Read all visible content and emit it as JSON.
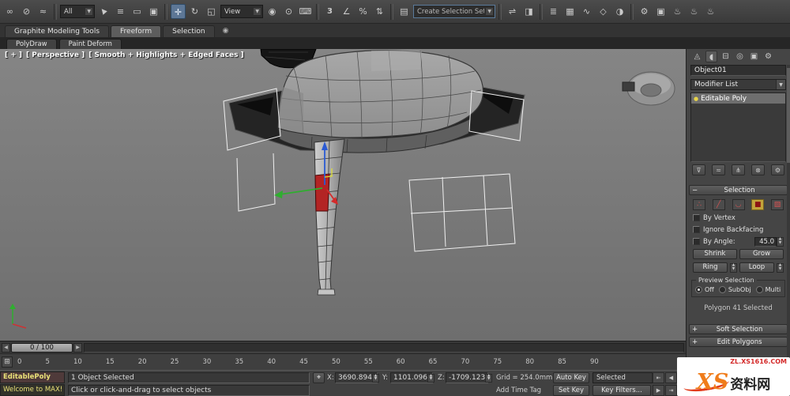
{
  "colors": {
    "selected_red": "#b32424",
    "gizmo_x": "#d42a2a",
    "gizmo_y": "#2fae2f",
    "gizmo_z": "#2a5ad4",
    "so_active_bg": "#c2a43c",
    "watermark_orange": "#f07c1a",
    "watermark_red": "#d42a2a"
  },
  "icons": {
    "dropdown_arrow": "▼",
    "spinner_up": "▲",
    "spinner_down": "▼",
    "rollout_open": "−",
    "rollout_closed": "+",
    "slider_left_arrow": "◀",
    "slider_right_arrow": "▶",
    "mini_curve_editor": "⊞",
    "stack_item_bulb": "●",
    "absolute_mode": "⌖",
    "ribbon_options": "◉"
  },
  "toolbar": {
    "items": [
      {
        "name": "select-and-link-icon",
        "glyph": "∞",
        "cls": "tb-icon"
      },
      {
        "name": "unlink-selection-icon",
        "glyph": "⊘",
        "cls": "tb-icon"
      },
      {
        "name": "bind-to-space-warp-icon",
        "glyph": "≈",
        "cls": "tb-icon"
      },
      {
        "kind": "sep",
        "name": "toolbar-separator",
        "cls": "tbsep",
        "interactable": false
      },
      {
        "kind": "drop",
        "name": "selection-filter-dropdown",
        "value": "All",
        "cls": "tb-drop w44"
      },
      {
        "name": "select-object-icon",
        "glyph": "▲",
        "cls": "tb-icon cursorrot"
      },
      {
        "name": "select-by-name-icon",
        "glyph": "≡",
        "cls": "tb-icon"
      },
      {
        "name": "rectangular-selection-region-icon",
        "glyph": "▭",
        "cls": "tb-icon"
      },
      {
        "name": "window-crossing-toggle-icon",
        "glyph": "▣",
        "cls": "tb-icon"
      },
      {
        "kind": "sep",
        "name": "toolbar-separator",
        "cls": "tbsep",
        "interactable": false
      },
      {
        "name": "select-and-move-icon",
        "glyph": "✛",
        "cls": "tb-icon active"
      },
      {
        "name": "select-and-rotate-icon",
        "glyph": "↻",
        "cls": "tb-icon"
      },
      {
        "name": "select-and-scale-icon",
        "glyph": "◱",
        "cls": "tb-icon"
      },
      {
        "kind": "drop",
        "name": "reference-coordinate-dropdown",
        "value": "View",
        "cls": "tb-drop w54"
      },
      {
        "name": "use-pivot-point-center-icon",
        "glyph": "◉",
        "cls": "tb-icon"
      },
      {
        "name": "select-and-manipulate-icon",
        "glyph": "⊙",
        "cls": "tb-icon"
      },
      {
        "name": "keyboard-shortcut-override-icon",
        "glyph": "⌨",
        "cls": "tb-icon"
      },
      {
        "kind": "sep",
        "name": "toolbar-separator",
        "cls": "tbsep",
        "interactable": false
      },
      {
        "name": "snaps-toggle-icon",
        "glyph": "3",
        "cls": "tb-icon snapnum"
      },
      {
        "name": "angle-snap-icon",
        "glyph": "∠",
        "cls": "tb-icon"
      },
      {
        "name": "percent-snap-icon",
        "glyph": "%",
        "cls": "tb-icon"
      },
      {
        "name": "spinner-snap-icon",
        "glyph": "⇅",
        "cls": "tb-icon"
      },
      {
        "kind": "sep",
        "name": "toolbar-separator",
        "cls": "tbsep",
        "interactable": false
      },
      {
        "name": "edit-named-selection-sets-icon",
        "glyph": "▤",
        "cls": "tb-icon"
      },
      {
        "kind": "drop",
        "name": "named-selection-set-combobox",
        "value": "Create Selection Set",
        "cls": "tb-drop combo w104"
      },
      {
        "kind": "sep",
        "name": "toolbar-separator",
        "cls": "tbsep",
        "interactable": false
      },
      {
        "name": "mirror-icon",
        "glyph": "⇌",
        "cls": "tb-icon"
      },
      {
        "name": "align-icon",
        "glyph": "◨",
        "cls": "tb-icon"
      },
      {
        "kind": "sep",
        "name": "toolbar-separator",
        "cls": "tbsep",
        "interactable": false
      },
      {
        "name": "layer-manager-icon",
        "glyph": "≣",
        "cls": "tb-icon"
      },
      {
        "name": "graphite-ribbon-toggle-icon",
        "glyph": "▦",
        "cls": "tb-icon"
      },
      {
        "name": "curve-editor-icon",
        "glyph": "∿",
        "cls": "tb-icon"
      },
      {
        "name": "schematic-view-icon",
        "glyph": "◇",
        "cls": "tb-icon"
      },
      {
        "name": "material-editor-icon",
        "glyph": "◑",
        "cls": "tb-icon"
      },
      {
        "kind": "sep",
        "name": "toolbar-separator",
        "cls": "tbsep",
        "interactable": false
      },
      {
        "name": "render-setup-icon",
        "glyph": "⚙",
        "cls": "tb-icon"
      },
      {
        "name": "rendered-frame-window-icon",
        "glyph": "▣",
        "cls": "tb-icon"
      },
      {
        "name": "render-production-icon",
        "glyph": "♨",
        "cls": "tb-icon"
      },
      {
        "name": "render-iterative-icon",
        "glyph": "♨",
        "cls": "tb-icon"
      },
      {
        "name": "render-quick-icon",
        "glyph": "♨",
        "cls": "tb-icon"
      }
    ]
  },
  "ribbon": {
    "tabs": [
      {
        "label": "Graphite Modeling Tools"
      },
      {
        "label": "Freeform"
      },
      {
        "label": "Selection"
      }
    ],
    "subtabs": [
      {
        "label": "PolyDraw"
      },
      {
        "label": "Paint Deform"
      }
    ]
  },
  "viewport": {
    "label_segments": [
      "[ + ]",
      "[ Perspective ]",
      "[ Smooth + Highlights + Edged Faces ]"
    ]
  },
  "command_panel": {
    "tabs": [
      {
        "name": "create-tab",
        "glyph": "◬",
        "cls": "ptab"
      },
      {
        "name": "modify-tab",
        "glyph": "◖",
        "cls": "ptab active"
      },
      {
        "name": "hierarchy-tab",
        "glyph": "⊟",
        "cls": "ptab"
      },
      {
        "name": "motion-tab",
        "glyph": "◎",
        "cls": "ptab"
      },
      {
        "name": "display-tab",
        "glyph": "▣",
        "cls": "ptab"
      },
      {
        "name": "utilities-tab",
        "glyph": "⚙",
        "cls": "ptab"
      }
    ],
    "object_name": "Object01",
    "modifier_list": "Modifier List",
    "stack_items": [
      {
        "label": "Editable Poly"
      }
    ],
    "stack_buttons": [
      {
        "name": "pin-stack-button",
        "glyph": "⊽",
        "cls": "stackbtn"
      },
      {
        "name": "show-end-result-button",
        "glyph": "≂",
        "cls": "stackbtn"
      },
      {
        "name": "make-unique-button",
        "glyph": "⋔",
        "cls": "stackbtn"
      },
      {
        "name": "remove-modifier-button",
        "glyph": "⊗",
        "cls": "stackbtn"
      },
      {
        "name": "configure-modifier-sets-button",
        "glyph": "⚙",
        "cls": "stackbtn"
      }
    ],
    "rollout_selection": "Selection",
    "so_icons": [
      {
        "name": "vertex-mode-icon",
        "glyph": "∴",
        "cls": "so-icon"
      },
      {
        "name": "edge-mode-icon",
        "glyph": "╱",
        "cls": "so-icon"
      },
      {
        "name": "border-mode-icon",
        "glyph": "◡",
        "cls": "so-icon"
      },
      {
        "name": "polygon-mode-icon",
        "glyph": "■",
        "cls": "so-icon active"
      },
      {
        "name": "element-mode-icon",
        "glyph": "▧",
        "cls": "so-icon"
      }
    ],
    "by_vertex": "By Vertex",
    "ignore_backfacing": "Ignore Backfacing",
    "by_angle": "By Angle:",
    "by_angle_value": "45.0",
    "shrink": "Shrink",
    "grow": "Grow",
    "ring": "Ring",
    "loop": "Loop",
    "preview_label": "Preview Selection",
    "preview_off": "Off",
    "preview_subobj": "SubObj",
    "preview_multi": "Multi",
    "selection_info": "Polygon 41 Selected",
    "rollout_soft_selection": "Soft Selection",
    "rollout_edit_polygons": "Edit Polygons"
  },
  "timeline": {
    "slider_label": "0 / 100"
  },
  "trackbar": {
    "ticks": [
      {
        "label": "0",
        "cls": "tick",
        "name": "trackbar-tick",
        "interactable": false
      },
      {
        "label": "5",
        "cls": "tick",
        "name": "trackbar-tick",
        "interactable": false
      },
      {
        "label": "10",
        "cls": "tick",
        "name": "trackbar-tick",
        "interactable": false
      },
      {
        "label": "15",
        "cls": "tick",
        "name": "trackbar-tick",
        "interactable": false
      },
      {
        "label": "20",
        "cls": "tick",
        "name": "trackbar-tick",
        "interactable": false
      },
      {
        "label": "25",
        "cls": "tick",
        "name": "trackbar-tick",
        "interactable": false
      },
      {
        "label": "30",
        "cls": "tick",
        "name": "trackbar-tick",
        "interactable": false
      },
      {
        "label": "35",
        "cls": "tick",
        "name": "trackbar-tick",
        "interactable": false
      },
      {
        "label": "40",
        "cls": "tick",
        "name": "trackbar-tick",
        "interactable": false
      },
      {
        "label": "45",
        "cls": "tick",
        "name": "trackbar-tick",
        "interactable": false
      },
      {
        "label": "50",
        "cls": "tick",
        "name": "trackbar-tick",
        "interactable": false
      },
      {
        "label": "55",
        "cls": "tick",
        "name": "trackbar-tick",
        "interactable": false
      },
      {
        "label": "60",
        "cls": "tick",
        "name": "trackbar-tick",
        "interactable": false
      },
      {
        "label": "65",
        "cls": "tick",
        "name": "trackbar-tick",
        "interactable": false
      },
      {
        "label": "70",
        "cls": "tick",
        "name": "trackbar-tick",
        "interactable": false
      },
      {
        "label": "75",
        "cls": "tick",
        "name": "trackbar-tick",
        "interactable": false
      },
      {
        "label": "80",
        "cls": "tick",
        "name": "trackbar-tick",
        "interactable": false
      },
      {
        "label": "85",
        "cls": "tick",
        "name": "trackbar-tick",
        "interactable": false
      },
      {
        "label": "90",
        "cls": "tick",
        "name": "trackbar-tick",
        "interactable": false
      }
    ]
  },
  "statusbar": {
    "macro_line": "EditablePoly",
    "listener_line": "Welcome to MAX!",
    "selection_status": "1 Object Selected",
    "prompt": "Click or click-and-drag to select objects",
    "x_label": "X:",
    "x_value": "3690.894",
    "y_label": "Y:",
    "y_value": "1101.096",
    "z_label": "Z:",
    "z_value": "-1709.123",
    "grid_label": "Grid = 254.0mm",
    "add_time_tag": "Add Time Tag",
    "auto_key": "Auto Key",
    "set_key": "Set Key",
    "selection_set_value": "Selected",
    "key_filters": "Key Filters...",
    "playback": [
      {
        "name": "go-to-start-button",
        "glyph": "⇤",
        "cls": "pbtn"
      },
      {
        "name": "previous-frame-button",
        "glyph": "◀",
        "cls": "pbtn"
      },
      {
        "name": "play-button",
        "glyph": "▶",
        "cls": "pbtn"
      },
      {
        "name": "go-to-end-button",
        "glyph": "⇥",
        "cls": "pbtn"
      }
    ]
  },
  "watermark": {
    "url": "ZL.XS1616.COM",
    "logo_latin": "XS",
    "logo_cjk": "资料网"
  }
}
